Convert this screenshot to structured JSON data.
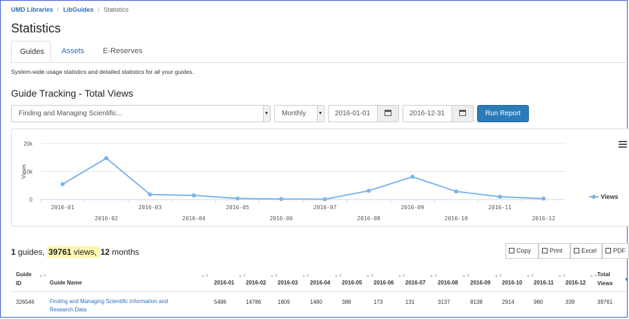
{
  "breadcrumb": {
    "items": [
      "UMD Libraries",
      "LibGuides",
      "Statistics"
    ]
  },
  "page_title": "Statistics",
  "tabs": [
    {
      "label": "Guides"
    },
    {
      "label": "Assets"
    },
    {
      "label": "E-Reserves"
    }
  ],
  "description": "System-wide usage statistics and detailed statistics for all your guides.",
  "section_title": "Guide Tracking - Total Views",
  "controls": {
    "guide_select": "Finding and Managing Scientific...",
    "interval_select": "Monthly",
    "start_date": "2016-01-01",
    "end_date": "2016-12-31",
    "run_report_label": "Run Report"
  },
  "colors": {
    "accent": "#2b7bb9",
    "series": "#7cb5ec",
    "link": "#2a6ebb",
    "highlight": "#fcf8b3"
  },
  "chart_data": {
    "type": "line",
    "ylabel": "Views",
    "xlabel": "",
    "ylim": [
      0,
      20000
    ],
    "y_ticks": [
      "0",
      "10k",
      "20k"
    ],
    "categories": [
      "2016-01",
      "2016-02",
      "2016-03",
      "2016-04",
      "2016-05",
      "2016-06",
      "2016-07",
      "2016-08",
      "2016-09",
      "2016-10",
      "2016-11",
      "2016-12"
    ],
    "series": [
      {
        "name": "Views",
        "values": [
          5486,
          14786,
          1809,
          1480,
          388,
          173,
          131,
          3137,
          8138,
          2914,
          980,
          339
        ]
      }
    ],
    "legend_position": "right",
    "grid": true,
    "menu_icon": "hamburger-menu-icon"
  },
  "summary": {
    "guides": "1",
    "guides_text": " guides, ",
    "views": "39761",
    "views_text": " views, ",
    "months": "12",
    "months_text": " months"
  },
  "export_buttons": [
    {
      "label": "Copy",
      "icon": "copy-icon"
    },
    {
      "label": "Print",
      "icon": "print-icon"
    },
    {
      "label": "Excel",
      "icon": "excel-icon"
    },
    {
      "label": "PDF",
      "icon": "pdf-icon"
    }
  ],
  "table": {
    "headers": {
      "guide_id_1": "Guide",
      "guide_id_2": "ID",
      "guide_name": "Guide Name",
      "months": [
        "2016-01",
        "2016-02",
        "2016-03",
        "2016-04",
        "2016-05",
        "2016-06",
        "2016-07",
        "2016-08",
        "2016-09",
        "2016-10",
        "2016-11",
        "2016-12"
      ],
      "total_1": "Total",
      "total_2": "Views"
    },
    "row": {
      "id": "326546",
      "name_1": "Finding and Managing Scientific Information and",
      "name_2": "Research Data",
      "values": [
        "5486",
        "14786",
        "1809",
        "1480",
        "388",
        "173",
        "131",
        "3137",
        "8138",
        "2914",
        "980",
        "339"
      ],
      "total": "39761"
    }
  }
}
